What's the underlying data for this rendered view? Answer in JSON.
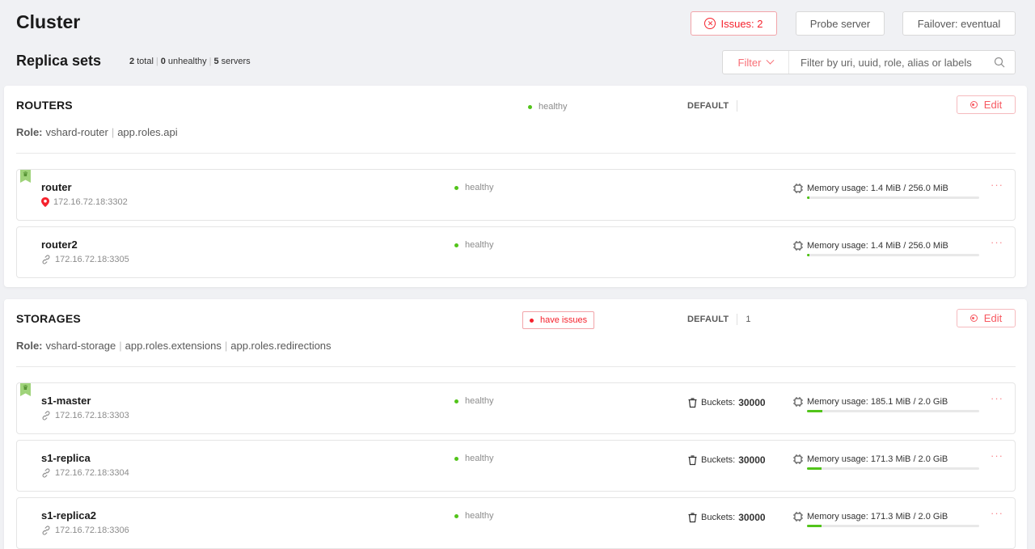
{
  "header": {
    "title": "Cluster",
    "issues_label": "Issues: 2",
    "probe_label": "Probe server",
    "failover_label": "Failover: eventual"
  },
  "replica_sets": {
    "title": "Replica sets",
    "total": "2",
    "total_suffix": "total",
    "unhealthy": "0",
    "unhealthy_suffix": "unhealthy",
    "servers": "5",
    "servers_suffix": "servers",
    "filter_label": "Filter",
    "filter_placeholder": "Filter by uri, uuid, role, alias or labels"
  },
  "routers": {
    "name": "ROUTERS",
    "status": "healthy",
    "vshard_group": "DEFAULT",
    "edit_label": "Edit",
    "role_prefix": "Role:",
    "roles": [
      "vshard-router",
      "app.roles.api"
    ],
    "servers": [
      {
        "name": "router",
        "uri": "172.16.72.18:3302",
        "status": "healthy",
        "memory": "Memory usage: 1.4 MiB / 256.0 MiB",
        "memory_fraction": 0.0055,
        "leader": true
      },
      {
        "name": "router2",
        "uri": "172.16.72.18:3305",
        "status": "healthy",
        "memory": "Memory usage: 1.4 MiB / 256.0 MiB",
        "memory_fraction": 0.0055,
        "leader": false
      }
    ]
  },
  "storages": {
    "name": "STORAGES",
    "status": "have issues",
    "vshard_group": "DEFAULT",
    "weight": "1",
    "edit_label": "Edit",
    "role_prefix": "Role:",
    "roles": [
      "vshard-storage",
      "app.roles.extensions",
      "app.roles.redirections"
    ],
    "servers": [
      {
        "name": "s1-master",
        "uri": "172.16.72.18:3303",
        "status": "healthy",
        "buckets_label": "Buckets:",
        "buckets": "30000",
        "memory": "Memory usage: 185.1 MiB / 2.0 GiB",
        "memory_fraction": 0.09,
        "leader": true
      },
      {
        "name": "s1-replica",
        "uri": "172.16.72.18:3304",
        "status": "healthy",
        "buckets_label": "Buckets:",
        "buckets": "30000",
        "memory": "Memory usage: 171.3 MiB / 2.0 GiB",
        "memory_fraction": 0.084,
        "leader": false
      },
      {
        "name": "s1-replica2",
        "uri": "172.16.72.18:3306",
        "status": "healthy",
        "buckets_label": "Buckets:",
        "buckets": "30000",
        "memory": "Memory usage: 171.3 MiB / 2.0 GiB",
        "memory_fraction": 0.084,
        "leader": false
      }
    ]
  },
  "more_label": "···",
  "colors": {
    "accent": "#f5222d",
    "healthy": "#52c41a",
    "leader": "#9fd37a"
  },
  "icons": {
    "issues": "close-circle-icon",
    "filter": "chevron-down-icon",
    "search": "search-icon",
    "edit": "edit-icon",
    "location": "location-pin-icon",
    "link": "link-icon",
    "memory": "chip-icon",
    "buckets": "bucket-icon",
    "leader": "crown-icon"
  }
}
